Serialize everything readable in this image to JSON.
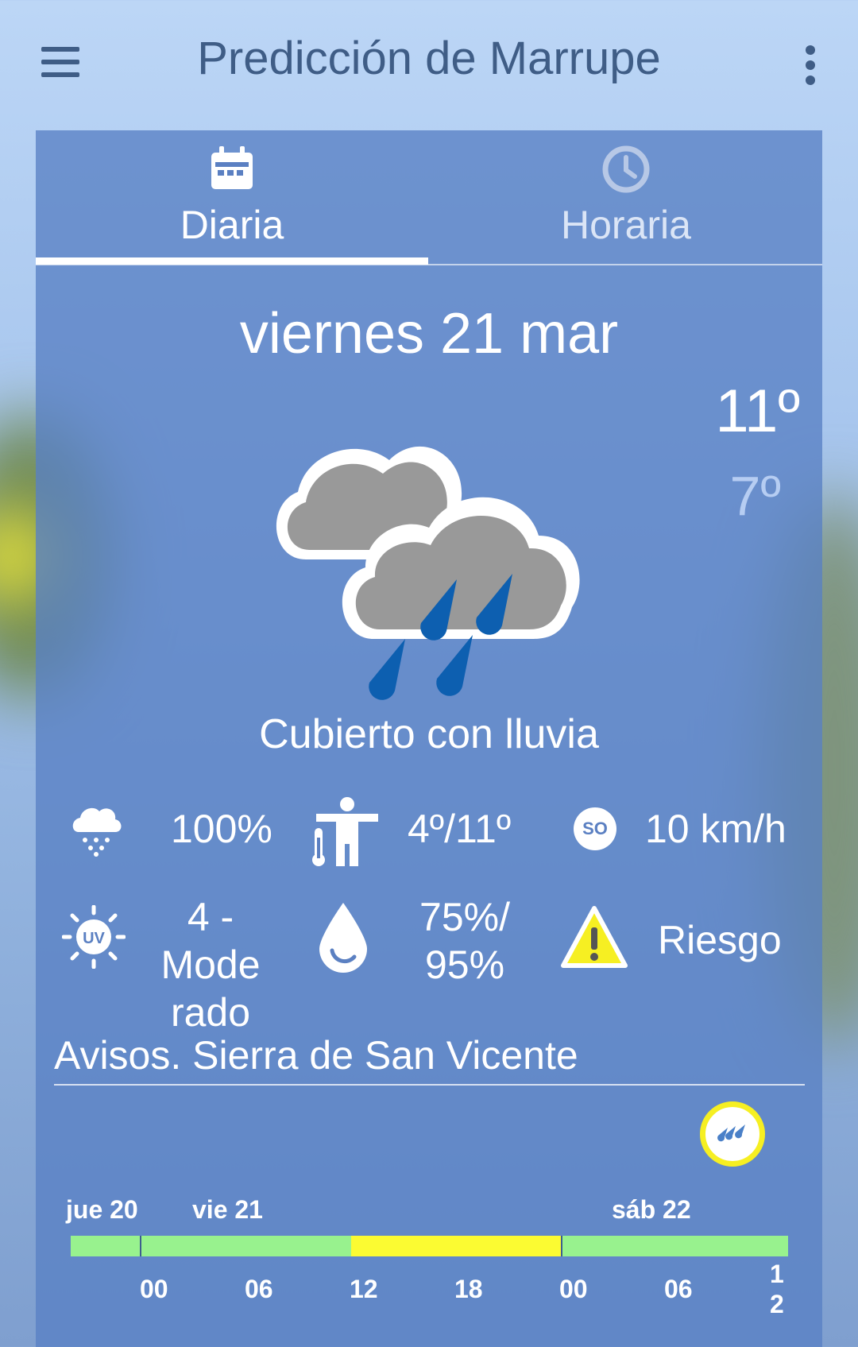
{
  "app_bar": {
    "title": "Predicción de Marrupe"
  },
  "tabs": [
    {
      "label": "Diaria",
      "selected": true
    },
    {
      "label": "Horaria",
      "selected": false
    }
  ],
  "forecast": {
    "date": "viernes 21 mar",
    "temp_max": "11º",
    "temp_min": "7º",
    "condition": "Cubierto con lluvia"
  },
  "details": {
    "rain_prob": "100%",
    "feels_like": "4º/11º",
    "wind_dir": "SO",
    "wind_speed": "10 km/h",
    "uv_label": "UV",
    "uv_line1": "4 - Mode",
    "uv_line2": "rado",
    "humidity_line1": "75%/",
    "humidity_line2": "95%",
    "warning": "Riesgo"
  },
  "warnings": {
    "title": "Avisos. Sierra de San Vicente",
    "days": [
      "jue 20",
      "vie 21",
      "sáb 22"
    ],
    "ticks": [
      "00",
      "06",
      "12",
      "18",
      "00",
      "06"
    ],
    "last_tick_line1": "1",
    "last_tick_line2": "2",
    "colors": {
      "green": "#98f28e",
      "yellow": "#fbfb32"
    }
  }
}
